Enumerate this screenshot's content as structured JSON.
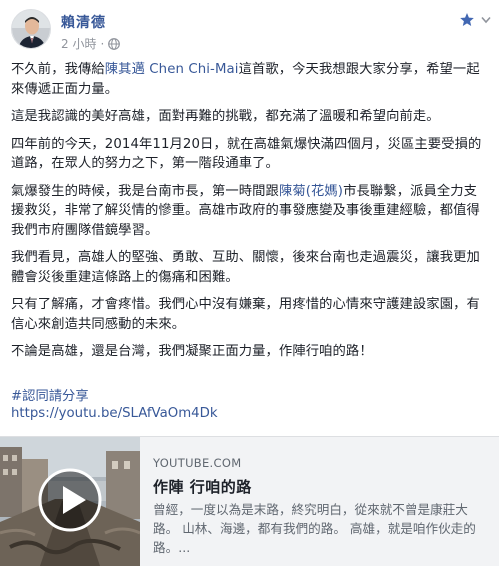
{
  "post": {
    "author": "賴清德",
    "time": "2 小時",
    "time_separator": "·",
    "audience_icon": "globe-icon",
    "header_icons": [
      "star-icon",
      "chevron-down-icon"
    ],
    "paragraphs": [
      {
        "parts": [
          {
            "text": "不久前，我傳給"
          },
          {
            "text": "陳其邁 Chen Chi-Mai",
            "link": true
          },
          {
            "text": "這首歌，今天我想跟大家分享，希望一起來傳遞正面力量。"
          }
        ]
      },
      {
        "parts": [
          {
            "text": "這是我認識的美好高雄，面對再難的挑戰，都充滿了溫暖和希望向前走。"
          }
        ]
      },
      {
        "parts": [
          {
            "text": "四年前的今天，2014年11月20日，就在高雄氣爆快滿四個月，災區主要受損的道路，在眾人的努力之下，第一階段通車了。"
          }
        ]
      },
      {
        "parts": [
          {
            "text": "氣爆發生的時候，我是台南市長，第一時間跟"
          },
          {
            "text": "陳菊(花媽)",
            "link": true
          },
          {
            "text": "市長聯繫，派員全力支援救災，非常了解災情的慘重。高雄市政府的事發應變及事後重建經驗，都值得我們市府團隊借鏡學習。"
          }
        ]
      },
      {
        "parts": [
          {
            "text": "我們看見，高雄人的堅強、勇敢、互助、關懷，後來台南也走過震災，讓我更加體會災後重建這條路上的傷痛和困難。"
          }
        ]
      },
      {
        "parts": [
          {
            "text": "只有了解痛，才會疼惜。我們心中沒有嫌棄，用疼惜的心情來守護建設家園，有信心來創造共同感動的未來。"
          }
        ]
      },
      {
        "parts": [
          {
            "text": "不論是高雄，還是台灣，我們凝聚正面力量，作陣行咱的路！"
          }
        ]
      }
    ],
    "hashtag": "#認同請分享",
    "url": "https://youtu.be/SLAfVaOm4Dk"
  },
  "link_card": {
    "domain": "YOUTUBE.COM",
    "title": "作陣 行咱的路",
    "description": "曾經，一度以為是末路，終究明白，從來就不曾是康莊大路。 山林、海邊，都有我們的路。 高雄，就是咱作伙走的路。...",
    "play_icon": "play-icon"
  },
  "colors": {
    "link": "#385898",
    "text": "#1d2129",
    "meta": "#90949c",
    "card_bg": "#f2f3f5",
    "card_meta": "#606770"
  }
}
